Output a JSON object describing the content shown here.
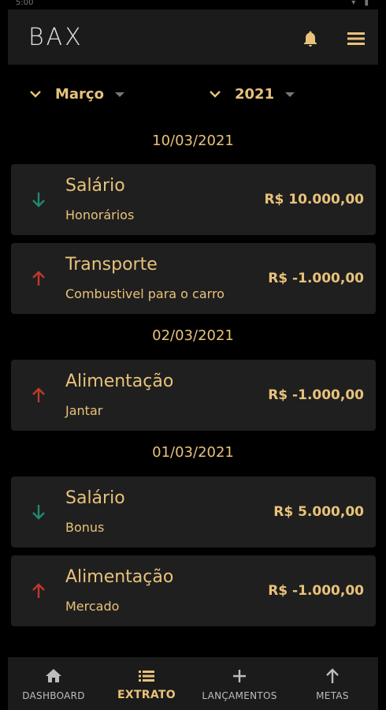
{
  "status_bar": {
    "time": "5:00"
  },
  "app": {
    "logo": "BAX",
    "icons": {
      "notifications": "bell-icon",
      "menu": "menu-icon"
    }
  },
  "filters": {
    "month": {
      "value": "Março",
      "icon": "chevron-down-icon"
    },
    "year": {
      "value": "2021",
      "icon": "chevron-down-icon"
    }
  },
  "groups": [
    {
      "date": "10/03/2021",
      "items": [
        {
          "title": "Salário",
          "subtitle": "Honorários",
          "amount": "R$ 10.000,00",
          "type": "income"
        },
        {
          "title": "Transporte",
          "subtitle": "Combustivel para o carro",
          "amount": "R$ -1.000,00",
          "type": "expense"
        }
      ]
    },
    {
      "date": "02/03/2021",
      "items": [
        {
          "title": "Alimentação",
          "subtitle": "Jantar",
          "amount": "R$ -1.000,00",
          "type": "expense"
        }
      ]
    },
    {
      "date": "01/03/2021",
      "items": [
        {
          "title": "Salário",
          "subtitle": "Bonus",
          "amount": "R$ 5.000,00",
          "type": "income"
        },
        {
          "title": "Alimentação",
          "subtitle": "Mercado",
          "amount": "R$ -1.000,00",
          "type": "expense"
        }
      ]
    }
  ],
  "nav": [
    {
      "label": "DASHBOARD",
      "icon": "home-icon",
      "active": false
    },
    {
      "label": "EXTRATO",
      "icon": "list-icon",
      "active": true
    },
    {
      "label": "LANÇAMENTOS",
      "icon": "plus-icon",
      "active": false
    },
    {
      "label": "METAS",
      "icon": "arrow-up-icon",
      "active": false
    }
  ],
  "colors": {
    "accent": "#e8c27a",
    "income": "#1f8a70",
    "expense": "#c0392b",
    "card": "#1f1f1f",
    "bar": "#1b1b1b"
  }
}
